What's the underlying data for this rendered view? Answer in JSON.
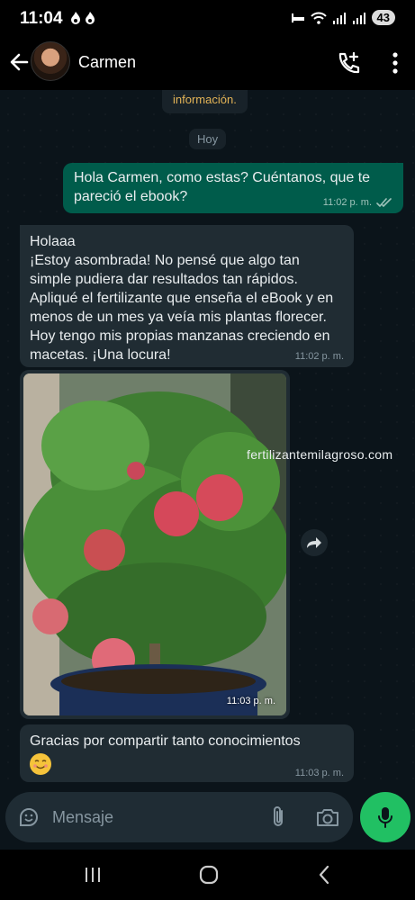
{
  "status_bar": {
    "time": "11:04",
    "battery": "43"
  },
  "header": {
    "contact_name": "Carmen"
  },
  "chat": {
    "system_text": "información.",
    "day_label": "Hoy",
    "messages": [
      {
        "direction": "out",
        "text": "Hola Carmen, como estas? Cuéntanos, que te pareció el ebook?",
        "time": "11:02 p. m."
      },
      {
        "direction": "in",
        "text": "Holaaa\n¡Estoy asombrada! No pensé que algo tan simple pudiera dar resultados tan rápidos. Apliqué el fertilizante que enseña el eBook y en menos de un mes ya veía mis plantas florecer. Hoy tengo mis propias manzanas creciendo en macetas. ¡Una locura!",
        "time": "11:02 p. m."
      },
      {
        "direction": "in",
        "type": "image",
        "time": "11:03 p. m."
      },
      {
        "direction": "in",
        "text": "Gracias por compartir tanto conocimientos",
        "time": "11:03 p. m."
      }
    ],
    "watermark": "fertilizantemilagroso.com"
  },
  "input": {
    "placeholder": "Mensaje"
  },
  "icons": {
    "back": "arrow-left-icon",
    "call": "add-call-icon",
    "menu": "more-vert-icon",
    "sticker": "sticker-icon",
    "attach": "paperclip-icon",
    "camera": "camera-icon",
    "mic": "mic-icon",
    "forward": "forward-icon",
    "emoji": "smiling-face-emoji"
  },
  "colors": {
    "outgoing_bubble": "#005c4b",
    "incoming_bubble": "#202c33",
    "accent": "#21c063",
    "background": "#0b141a"
  }
}
